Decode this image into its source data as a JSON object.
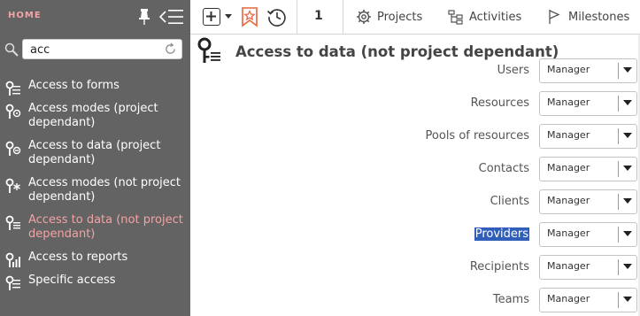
{
  "sidebar": {
    "home_label": "HOME",
    "search": {
      "value": "acc",
      "placeholder": ""
    },
    "items": [
      {
        "label": "Access to forms",
        "icon": "key-forms-icon",
        "active": false
      },
      {
        "label": "Access modes (project dependant)",
        "icon": "key-modes-icon",
        "active": false
      },
      {
        "label": "Access to data (project dependant)",
        "icon": "key-data-project-icon",
        "active": false
      },
      {
        "label": "Access modes (not project dependant)",
        "icon": "key-modes-star-icon",
        "active": false
      },
      {
        "label": "Access to data (not project dependant)",
        "icon": "key-list-icon",
        "active": true
      },
      {
        "label": "Access to reports",
        "icon": "key-reports-icon",
        "active": false
      },
      {
        "label": "Specific access",
        "icon": "key-specific-icon",
        "active": false
      }
    ]
  },
  "topbar": {
    "counter": "1",
    "tabs": [
      {
        "label": "Projects",
        "icon": "gear-icon"
      },
      {
        "label": "Activities",
        "icon": "hierarchy-icon"
      },
      {
        "label": "Milestones",
        "icon": "flag-icon"
      }
    ]
  },
  "main": {
    "title": "Access to data (not project dependant)",
    "rows": [
      {
        "label": "Users",
        "value": "Manager",
        "highlighted": false
      },
      {
        "label": "Resources",
        "value": "Manager",
        "highlighted": false
      },
      {
        "label": "Pools of resources",
        "value": "Manager",
        "highlighted": false
      },
      {
        "label": "Contacts",
        "value": "Manager",
        "highlighted": false
      },
      {
        "label": "Clients",
        "value": "Manager",
        "highlighted": false
      },
      {
        "label": "Providers",
        "value": "Manager",
        "highlighted": true
      },
      {
        "label": "Recipients",
        "value": "Manager",
        "highlighted": false
      },
      {
        "label": "Teams",
        "value": "Manager",
        "highlighted": false
      }
    ]
  },
  "colors": {
    "sidebar_bg": "#636363",
    "active_text": "#f2a3a3",
    "highlight": "#2f5fb8",
    "favorite_icon": "#e8643c"
  }
}
